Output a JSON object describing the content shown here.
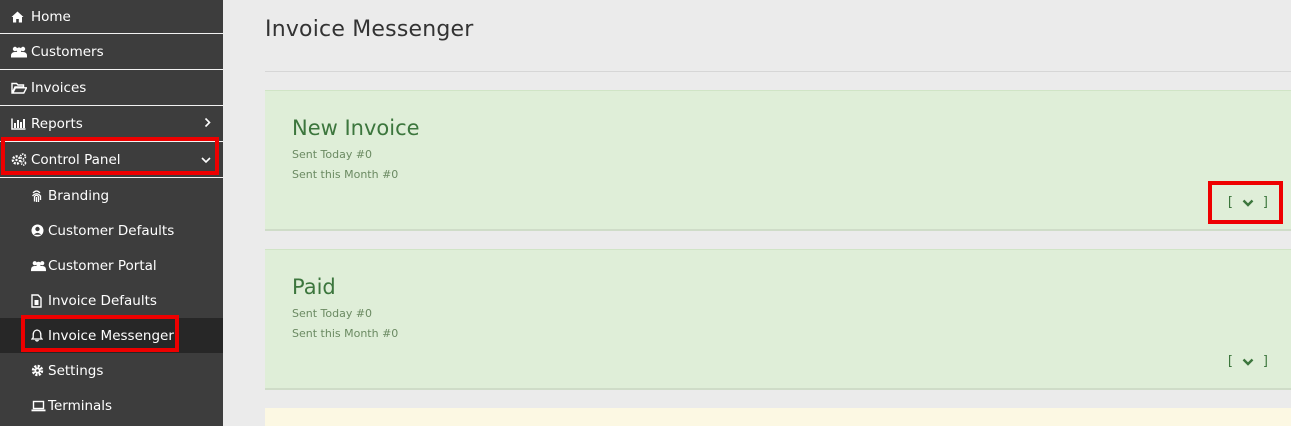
{
  "sidebar": {
    "items": [
      {
        "label": "Home",
        "icon": "home-icon"
      },
      {
        "label": "Customers",
        "icon": "users-icon"
      },
      {
        "label": "Invoices",
        "icon": "folder-open-icon"
      },
      {
        "label": "Reports",
        "icon": "bar-chart-icon"
      },
      {
        "label": "Control Panel",
        "icon": "gears-icon"
      }
    ],
    "control_panel_items": [
      {
        "label": "Branding",
        "icon": "fingerprint-icon"
      },
      {
        "label": "Customer Defaults",
        "icon": "user-circle-icon"
      },
      {
        "label": "Customer Portal",
        "icon": "users-icon"
      },
      {
        "label": "Invoice Defaults",
        "icon": "file-invoice-icon"
      },
      {
        "label": "Invoice Messenger",
        "icon": "bell-icon"
      },
      {
        "label": "Settings",
        "icon": "cog-icon"
      },
      {
        "label": "Terminals",
        "icon": "laptop-icon"
      }
    ]
  },
  "main": {
    "title": "Invoice Messenger",
    "cards": [
      {
        "title": "New Invoice",
        "sent_today": "Sent Today #0",
        "sent_month": "Sent this Month #0",
        "toggle_open": "[",
        "toggle_close": "]"
      },
      {
        "title": "Paid",
        "sent_today": "Sent Today #0",
        "sent_month": "Sent this Month #0",
        "toggle_open": "[",
        "toggle_close": "]"
      }
    ]
  },
  "colors": {
    "sidebar_bg": "#3d3d3d",
    "sidebar_active_bg": "#272727",
    "highlight": "#ee0000",
    "card_green": "#dfeed8",
    "card_text_green": "#3c763d",
    "card_yellow": "#fcf8e3"
  }
}
